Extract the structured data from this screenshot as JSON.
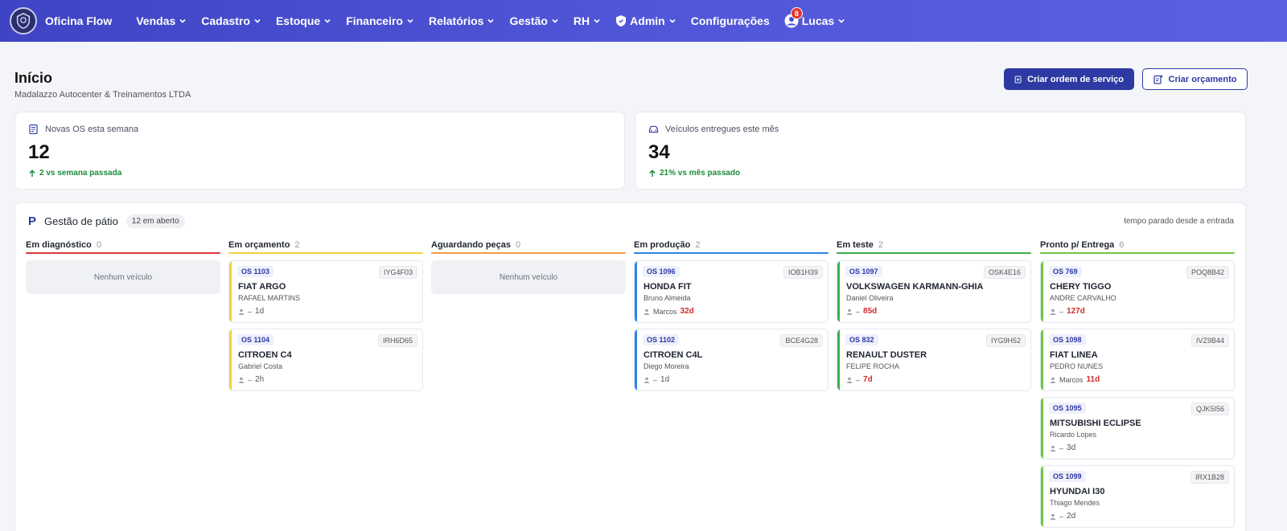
{
  "header": {
    "brand": "Oficina Flow",
    "nav": [
      {
        "label": "Vendas"
      },
      {
        "label": "Cadastro"
      },
      {
        "label": "Estoque"
      },
      {
        "label": "Financeiro"
      },
      {
        "label": "Relatórios"
      },
      {
        "label": "Gestão"
      },
      {
        "label": "RH"
      },
      {
        "label": "Admin"
      },
      {
        "label": "Configurações"
      }
    ],
    "user": {
      "name": "Lucas",
      "notifications": "8"
    }
  },
  "page": {
    "title": "Início",
    "subtitle": "Madalazzo Autocenter & Treinamentos LTDA",
    "actions": {
      "new_os": "Criar ordem de serviço",
      "new_quote": "Criar orçamento"
    }
  },
  "stats": {
    "new_os": {
      "label": "Novas OS esta semana",
      "value": "12",
      "delta": "2 vs semana passada"
    },
    "delivered": {
      "label": "Veículos entregues este mês",
      "value": "34",
      "delta": "21% vs mês passado"
    }
  },
  "board": {
    "title": "Gestão de pátio",
    "open_badge": "12 em aberto",
    "note": "tempo parado desde a entrada",
    "empty_text": "Nenhum veículo",
    "columns": [
      {
        "name": "Em diagnóstico",
        "count": "0",
        "color": "#e0353a",
        "cards": []
      },
      {
        "name": "Em orçamento",
        "count": "2",
        "color": "#f3d23a",
        "cards": [
          {
            "os": "OS 1103",
            "plate": "IYG4F03",
            "model": "FIAT ARGO",
            "customer": "RAFAEL MARTINS",
            "tech": "–",
            "time": "1d",
            "late": false
          },
          {
            "os": "OS 1104",
            "plate": "IRH6D65",
            "model": "CITROEN C4",
            "customer": "Gabriel Costa",
            "tech": "–",
            "time": "2h",
            "late": false
          }
        ]
      },
      {
        "name": "Aguardando peças",
        "count": "0",
        "color": "#f59a3a",
        "cards": []
      },
      {
        "name": "Em produção",
        "count": "2",
        "color": "#2e86de",
        "cards": [
          {
            "os": "OS 1096",
            "plate": "IOB1H39",
            "model": "HONDA FIT",
            "customer": "Bruno Almeida",
            "tech": "Marcos",
            "time": "32d",
            "late": true
          },
          {
            "os": "OS 1102",
            "plate": "BCE4G28",
            "model": "CITROEN C4L",
            "customer": "Diego Moreira",
            "tech": "–",
            "time": "1d",
            "late": false
          }
        ]
      },
      {
        "name": "Em teste",
        "count": "2",
        "color": "#3fae49",
        "cards": [
          {
            "os": "OS 1097",
            "plate": "OSK4E16",
            "model": "VOLKSWAGEN KARMANN-GHIA",
            "customer": "Daniel Oliveira",
            "tech": "–",
            "time": "85d",
            "late": true
          },
          {
            "os": "OS 832",
            "plate": "IYG9H52",
            "model": "RENAULT DUSTER",
            "customer": "FELIPE ROCHA",
            "tech": "–",
            "time": "7d",
            "late": true
          }
        ]
      },
      {
        "name": "Pronto p/ Entrega",
        "count": "6",
        "color": "#6cc644",
        "cards": [
          {
            "os": "OS 769",
            "plate": "POQ8B42",
            "model": "CHERY TIGGO",
            "customer": "ANDRE CARVALHO",
            "tech": "–",
            "time": "127d",
            "late": true
          },
          {
            "os": "OS 1098",
            "plate": "IVZ9B44",
            "model": "FIAT LINEA",
            "customer": "PEDRO NUNES",
            "tech": "Marcos",
            "time": "11d",
            "late": true
          },
          {
            "os": "OS 1095",
            "plate": "QJK5I56",
            "model": "MITSUBISHI ECLIPSE",
            "customer": "Ricardo Lopes",
            "tech": "–",
            "time": "3d",
            "late": false
          },
          {
            "os": "OS 1099",
            "plate": "IRX1B28",
            "model": "HYUNDAI I30",
            "customer": "Thiago Mendes",
            "tech": "–",
            "time": "2d",
            "late": false
          }
        ]
      }
    ]
  }
}
